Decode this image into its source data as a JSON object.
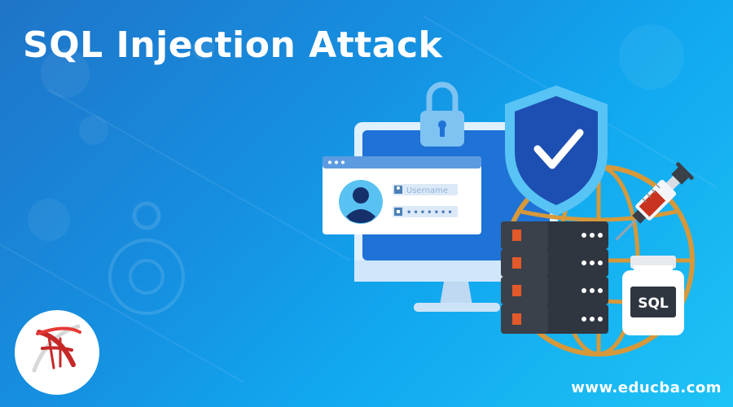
{
  "banner": {
    "title": "SQL Injection Attack",
    "site_url": "www.educba.com"
  },
  "login_window": {
    "username_placeholder": "Username",
    "password_mask": "•••••••"
  },
  "sql_vial": {
    "label": "SQL"
  },
  "icons": {
    "lock": "padlock-icon",
    "shield": "shield-check-icon",
    "globe": "globe-icon",
    "server": "server-stack-icon",
    "syringe": "syringe-icon",
    "user": "user-avatar-icon",
    "logo": "sql-server-logo"
  },
  "colors": {
    "background_start": "#1f74c8",
    "background_end": "#1ec3f6",
    "title": "#ffffff",
    "server": "#2f3640",
    "server_accent": "#e2592a",
    "globe": "#d7983a",
    "shield": "#1d4fb2"
  }
}
